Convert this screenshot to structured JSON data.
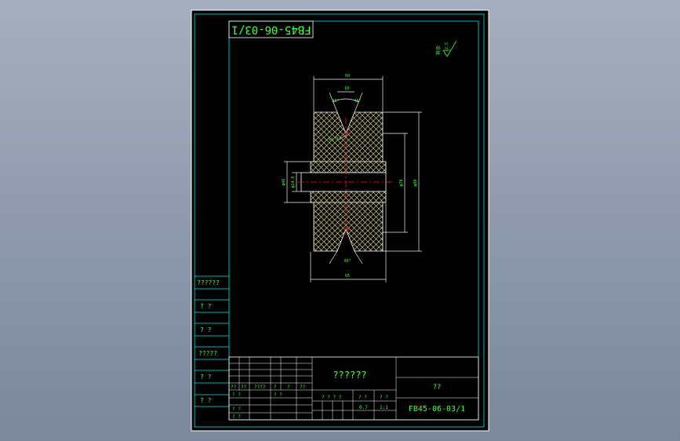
{
  "sheet": {
    "drawing_number_stamp": "FB45-06-03/1",
    "roughness": "12.5",
    "roughness_note": "其余"
  },
  "dimensions": {
    "top_overall": "60",
    "top_groove": "10",
    "top_left_angle": "45°",
    "top_right_angle": "45°",
    "left_outer": "φ46",
    "left_inner": "φ14.5",
    "right_inner": "φ70",
    "right_outer": "φ90",
    "groove_radius": "R1.5",
    "bottom_angle": "90°",
    "bottom_overall": "65"
  },
  "side_labels": [
    "??????",
    "?  ?",
    "?  ?",
    "?????",
    "?  ?",
    "?  ?"
  ],
  "title_block": {
    "title": "??????",
    "material": "??",
    "drawing_number": "FB45-06-03/1",
    "scale": "0.7",
    "sheets": "1:1",
    "stage_label": "? ? ? ?",
    "weight_label": "? ?",
    "scale_label": "? ?",
    "rev_headers": [
      "??",
      "??",
      "????",
      "?",
      "?",
      "??"
    ],
    "designer": "? ?",
    "checker": "? ?",
    "approver": "? ?",
    "std": "? ?"
  }
}
